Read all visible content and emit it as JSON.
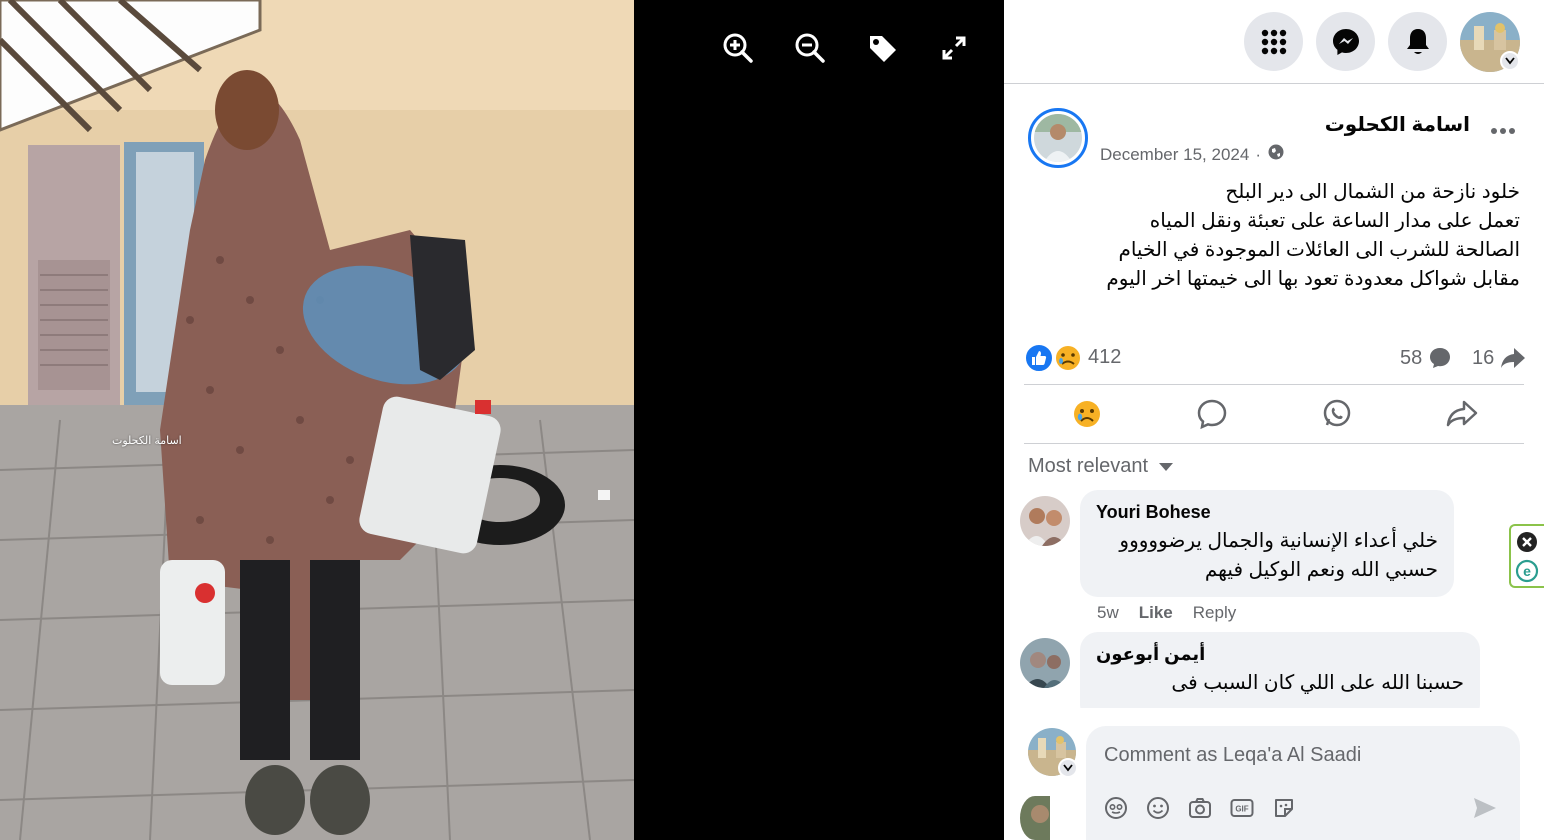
{
  "photo": {
    "watermark": "اسامة الكحلوت"
  },
  "viewer_tools": [
    "zoom-in-icon",
    "zoom-out-icon",
    "tag-icon",
    "fullscreen-icon"
  ],
  "top_bar": {
    "icons": [
      "menu-grid-icon",
      "messenger-icon",
      "bell-icon"
    ]
  },
  "post": {
    "author": "اسامة الكحلوت",
    "date": "December 15, 2024",
    "date_separator": "·",
    "text_lines": [
      "خلود نازحة من الشمال الى دير البلح",
      "تعمل على مدار الساعة على تعبئة ونقل المياه",
      "الصالحة للشرب الى العائلات الموجودة في الخيام",
      "مقابل شواكل معدودة تعود بها الى خيمتها اخر اليوم"
    ],
    "reactions_count": "412",
    "comments_count": "58",
    "shares_count": "16"
  },
  "sort_label": "Most relevant",
  "comments": [
    {
      "name": "Youri Bohese",
      "lines": [
        "خلي أعداء الإنسانية والجمال يرضووووو",
        "حسبي الله ونعم الوكيل فيهم"
      ],
      "time": "5w",
      "like": "Like",
      "reply": "Reply"
    },
    {
      "name": "أيمن أبوعون",
      "lines": [
        "حسبنا الله على اللي كان السبب فى"
      ],
      "time": "",
      "like": "",
      "reply": ""
    }
  ],
  "composer": {
    "placeholder": "Comment as Leqa'a Al Saadi"
  },
  "colors": {
    "accent": "#1877f2",
    "panel_bg": "#ffffff",
    "bubble_bg": "#f0f2f5",
    "muted": "#65676b"
  }
}
